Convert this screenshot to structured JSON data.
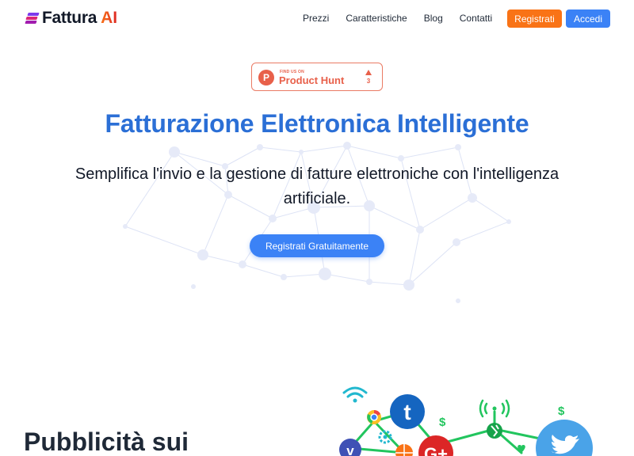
{
  "brand": {
    "name": "Fattura",
    "ai": "AI"
  },
  "nav": {
    "links": [
      "Prezzi",
      "Caratteristiche",
      "Blog",
      "Contatti"
    ],
    "register": "Registrati",
    "login": "Accedi"
  },
  "badge": {
    "small": "FIND US ON",
    "big": "Product Hunt",
    "count": "3",
    "logo_letter": "P"
  },
  "hero": {
    "title": "Fatturazione Elettronica Intelligente",
    "subtitle": "Semplifica l'invio e la gestione di fatture elettroniche con l'intelligenza artificiale.",
    "cta": "Registrati Gratuitamente"
  },
  "section": {
    "title": "Pubblicità sui"
  },
  "social_icons": [
    "wifi-icon",
    "chrome-icon",
    "tumblr-icon",
    "dollar-icon",
    "vine-icon",
    "google-plus-icon",
    "xing-icon",
    "twitter-icon",
    "settings-icon",
    "basketball-icon"
  ],
  "colors": {
    "primary": "#3b82f6",
    "accent": "#f97316",
    "title": "#2b6fd6",
    "product_hunt": "#e8604a"
  }
}
